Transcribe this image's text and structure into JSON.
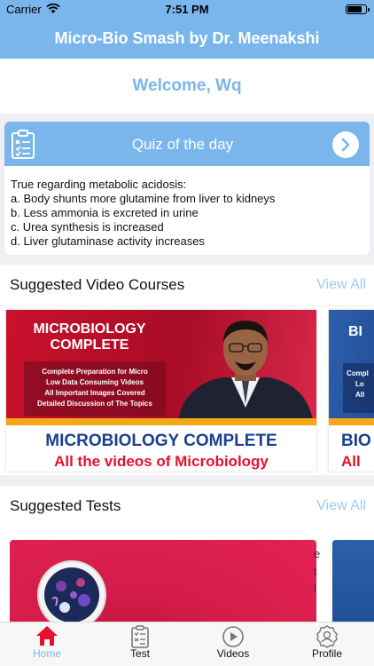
{
  "status_bar": {
    "carrier": "Carrier",
    "time": "7:51 PM",
    "battery_level": 0.8
  },
  "nav": {
    "title": "Micro-Bio Smash by Dr. Meenakshi"
  },
  "welcome": {
    "text": "Welcome, Wq"
  },
  "quiz": {
    "title": "Quiz of the day",
    "question": "True regarding metabolic acidosis:",
    "options": [
      "a. Body shunts more glutamine from liver to kidneys",
      "b. Less ammonia is excreted in urine",
      "c. Urea synthesis is increased",
      "d. Liver glutaminase activity increases"
    ]
  },
  "video_section": {
    "title": "Suggested Video Courses",
    "view_all": "View All",
    "courses": [
      {
        "banner_title_1": "MICROBIOLOGY",
        "banner_title_2": "COMPLETE",
        "banner_points": [
          "Complete Preparation for Micro",
          "Low Data Consuming Videos",
          "All Important Images Covered",
          "Detailed Discussion of The Topics"
        ],
        "name": "MICROBIOLOGY COMPLETE",
        "tagline": "All the videos of Microbiology"
      },
      {
        "banner_title": "BI",
        "banner_points": [
          "Compl",
          "Lo",
          "All"
        ],
        "name": "BIO",
        "tagline": "All"
      }
    ]
  },
  "test_section": {
    "title": "Suggested Tests",
    "view_all": "View All",
    "fragments": [
      "e",
      "t",
      "l"
    ]
  },
  "tabs": [
    {
      "label": "Home",
      "icon": "home-icon",
      "active": true
    },
    {
      "label": "Test",
      "icon": "test-icon",
      "active": false
    },
    {
      "label": "Videos",
      "icon": "play-icon",
      "active": false
    },
    {
      "label": "Profile",
      "icon": "profile-icon",
      "active": false
    }
  ],
  "colors": {
    "accent": "#7ab6ec",
    "course_red": "#e8112d",
    "course_blue": "#1b3f8f"
  }
}
